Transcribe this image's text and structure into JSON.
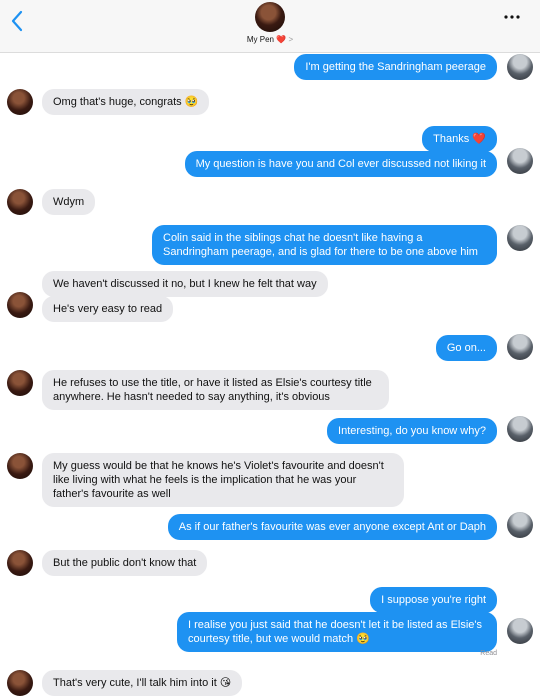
{
  "header": {
    "contact_name": "My Pen",
    "heart": "❤️",
    "chevron": ">"
  },
  "messages": [
    {
      "from": "me",
      "text": "I'm getting the Sandringham peerage"
    },
    {
      "from": "pen",
      "text": "Omg that's huge, congrats 🥹"
    },
    {
      "from": "me",
      "text": "Thanks ❤️"
    },
    {
      "from": "me",
      "text": "My question is have you and Col ever discussed not liking it"
    },
    {
      "from": "pen",
      "text": "Wdym"
    },
    {
      "from": "me",
      "text": "Colin said in the siblings chat he doesn't like having a Sandringham peerage, and is glad for there to be one above him"
    },
    {
      "from": "pen",
      "text": "We haven't discussed it no, but I knew he felt that way"
    },
    {
      "from": "pen",
      "text": "He's very easy to read"
    },
    {
      "from": "me",
      "text": "Go on..."
    },
    {
      "from": "pen",
      "text": "He refuses to use the title, or have it listed as Elsie's courtesy title anywhere. He hasn't needed to say anything, it's obvious"
    },
    {
      "from": "me",
      "text": "Interesting, do you know why?"
    },
    {
      "from": "pen",
      "text": "My guess would be that he knows he's Violet's favourite and doesn't like living with what he feels is the implication that he was your father's favourite as well"
    },
    {
      "from": "me",
      "text": "As if our father's favourite was ever anyone except Ant or Daph"
    },
    {
      "from": "pen",
      "text": "But the public don't know that"
    },
    {
      "from": "me",
      "text": "I suppose you're right"
    },
    {
      "from": "me",
      "text": "I realise you just said that he doesn't let it be listed as Elsie's courtesy title, but we would match 🥹"
    },
    {
      "from": "pen",
      "text": "That's very cute, I'll talk him into it 😘"
    }
  ],
  "status": {
    "read_receipt": "Read"
  }
}
